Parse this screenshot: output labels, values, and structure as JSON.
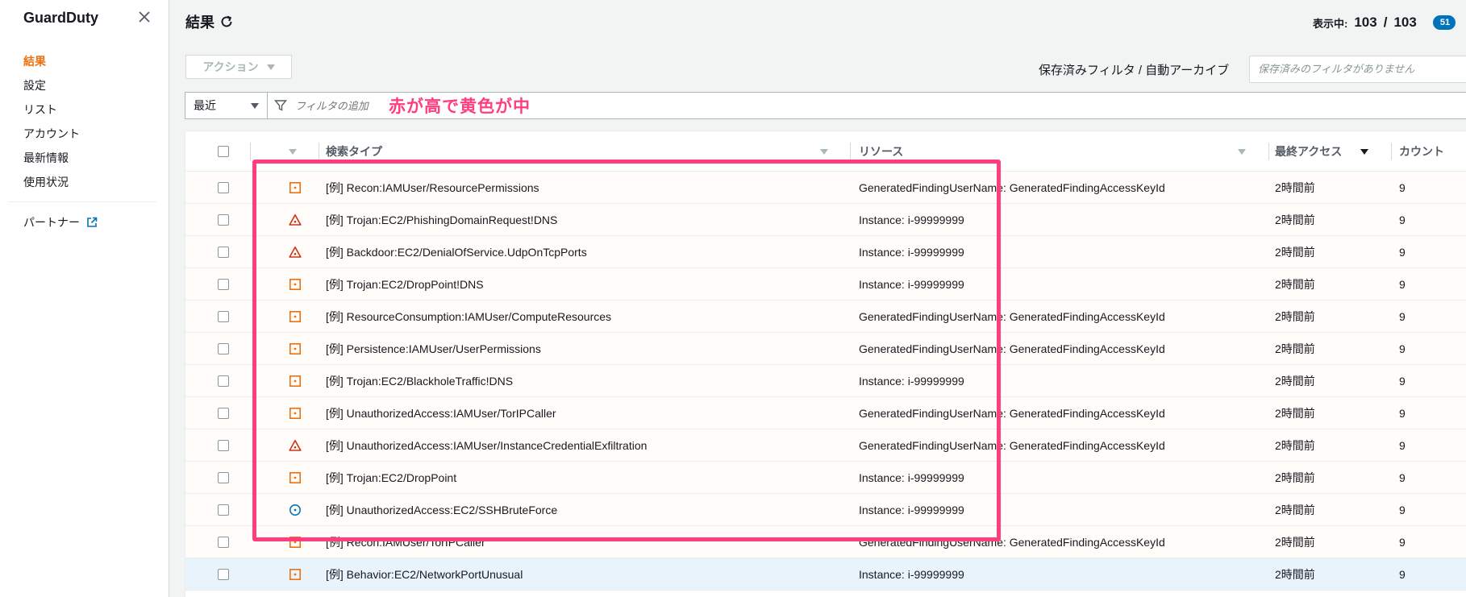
{
  "sidebar": {
    "title": "GuardDuty",
    "items": [
      {
        "label": "結果",
        "active": true
      },
      {
        "label": "設定",
        "active": false
      },
      {
        "label": "リスト",
        "active": false
      },
      {
        "label": "アカウント",
        "active": false
      },
      {
        "label": "最新情報",
        "active": false
      },
      {
        "label": "使用状況",
        "active": false
      }
    ],
    "partner_label": "パートナー"
  },
  "header": {
    "title": "結果",
    "showing_label": "表示中:",
    "shown_count": "103",
    "separator": "/",
    "total_count": "103",
    "badge_count": "51"
  },
  "toolbar": {
    "action_label": "アクション",
    "saved_filter_label": "保存済みフィルタ / 自動アーカイブ",
    "saved_filter_placeholder": "保存済みのフィルタがありません"
  },
  "filter": {
    "period_value": "最近",
    "placeholder": "フィルタの追加",
    "annotation": "赤が高で黄色が中"
  },
  "table": {
    "columns": {
      "finding_type": "検索タイプ",
      "resource": "リソース",
      "last_seen": "最終アクセス",
      "count": "カウント"
    },
    "rows": [
      {
        "severity": "medium",
        "type": "[例] Recon:IAMUser/ResourcePermissions",
        "resource": "GeneratedFindingUserName: GeneratedFindingAccessKeyId",
        "last_seen": "2時間前",
        "count": "9"
      },
      {
        "severity": "high",
        "type": "[例] Trojan:EC2/PhishingDomainRequest!DNS",
        "resource": "Instance: i-99999999",
        "last_seen": "2時間前",
        "count": "9"
      },
      {
        "severity": "high",
        "type": "[例] Backdoor:EC2/DenialOfService.UdpOnTcpPorts",
        "resource": "Instance: i-99999999",
        "last_seen": "2時間前",
        "count": "9"
      },
      {
        "severity": "medium",
        "type": "[例] Trojan:EC2/DropPoint!DNS",
        "resource": "Instance: i-99999999",
        "last_seen": "2時間前",
        "count": "9"
      },
      {
        "severity": "medium",
        "type": "[例] ResourceConsumption:IAMUser/ComputeResources",
        "resource": "GeneratedFindingUserName: GeneratedFindingAccessKeyId",
        "last_seen": "2時間前",
        "count": "9"
      },
      {
        "severity": "medium",
        "type": "[例] Persistence:IAMUser/UserPermissions",
        "resource": "GeneratedFindingUserName: GeneratedFindingAccessKeyId",
        "last_seen": "2時間前",
        "count": "9"
      },
      {
        "severity": "medium",
        "type": "[例] Trojan:EC2/BlackholeTraffic!DNS",
        "resource": "Instance: i-99999999",
        "last_seen": "2時間前",
        "count": "9"
      },
      {
        "severity": "medium",
        "type": "[例] UnauthorizedAccess:IAMUser/TorIPCaller",
        "resource": "GeneratedFindingUserName: GeneratedFindingAccessKeyId",
        "last_seen": "2時間前",
        "count": "9"
      },
      {
        "severity": "high",
        "type": "[例] UnauthorizedAccess:IAMUser/InstanceCredentialExfiltration",
        "resource": "GeneratedFindingUserName: GeneratedFindingAccessKeyId",
        "last_seen": "2時間前",
        "count": "9"
      },
      {
        "severity": "medium",
        "type": "[例] Trojan:EC2/DropPoint",
        "resource": "Instance: i-99999999",
        "last_seen": "2時間前",
        "count": "9"
      },
      {
        "severity": "low",
        "type": "[例] UnauthorizedAccess:EC2/SSHBruteForce",
        "resource": "Instance: i-99999999",
        "last_seen": "2時間前",
        "count": "9"
      },
      {
        "severity": "medium",
        "type": "[例] Recon:IAMUser/TorIPCaller",
        "resource": "GeneratedFindingUserName: GeneratedFindingAccessKeyId",
        "last_seen": "2時間前",
        "count": "9"
      },
      {
        "severity": "medium",
        "type": "[例] Behavior:EC2/NetworkPortUnusual",
        "resource": "Instance: i-99999999",
        "last_seen": "2時間前",
        "count": "9",
        "selected": true
      }
    ]
  },
  "colors": {
    "high": "#d13212",
    "medium": "#ec7211",
    "low": "#0073bb",
    "highlight": "#ff3d7f",
    "accent": "#ec7211"
  }
}
